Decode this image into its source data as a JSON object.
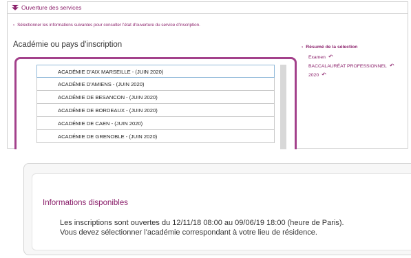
{
  "top_panel": {
    "header_title": "Ouverture des services",
    "intro_text": "Sélectionner les informations suivantes pour consulter l'état d'ouverture du service d'inscription.",
    "academie_title": "Académie ou pays d'inscription",
    "academies": [
      "ACADÉMIE D'AIX MARSEILLE - (JUIN 2020)",
      "ACADÉMIE D'AMIENS - (JUIN 2020)",
      "ACADÉMIE DE BESANCON - (JUIN 2020)",
      "ACADÉMIE DE BORDEAUX - (JUIN 2020)",
      "ACADÉMIE DE CAEN - (JUIN 2020)",
      "ACADÉMIE DE GRENOBLE - (JUIN 2020)"
    ],
    "selected_index": 0
  },
  "summary": {
    "title": "Résumé de la sélection",
    "items": [
      "Examen",
      "BACCALAURÉAT PROFESSIONNEL",
      "2020"
    ]
  },
  "bottom_panel": {
    "title": "Informations disponibles",
    "line1": "Les inscriptions sont ouvertes du 12/11/18 08:00 au 09/06/19 18:00 (heure de Paris).",
    "line2": "Vous devez sélectionner l'académie correspondant à votre lieu de résidence."
  },
  "colors": {
    "accent": "#8a1f6a",
    "list_border": "#a3418b"
  },
  "icons": {
    "header": "double-chevron-down-icon",
    "undo": "undo-arrow-icon",
    "bullet": "chevron-right-icon"
  }
}
